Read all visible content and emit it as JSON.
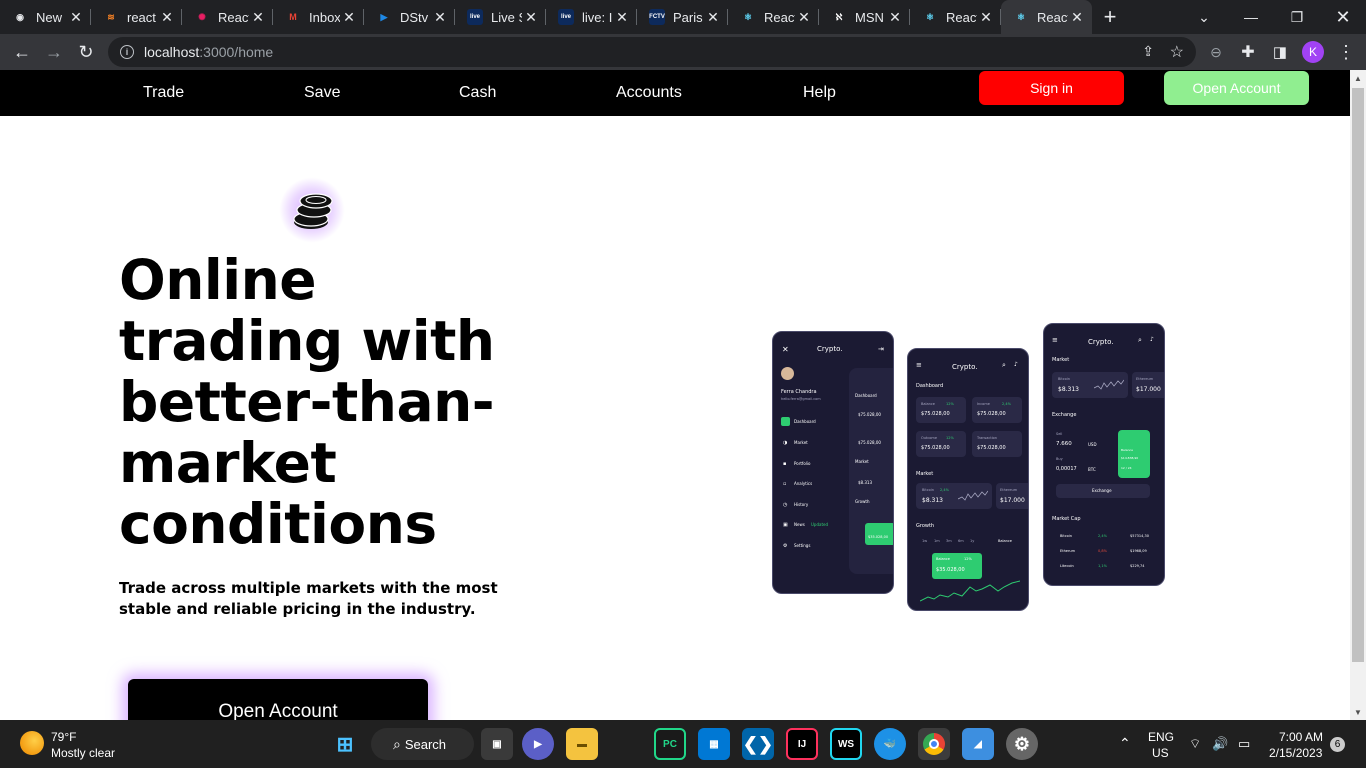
{
  "browser": {
    "tabs": [
      {
        "title": "New",
        "fav_color": "#e8eaed",
        "fav_glyph": "◉"
      },
      {
        "title": "react",
        "fav_color": "#f48024",
        "fav_glyph": "≋"
      },
      {
        "title": "React",
        "fav_color": "#e91e63",
        "fav_glyph": "✺"
      },
      {
        "title": "Inbox",
        "fav_color": "#ea4335",
        "fav_glyph": "M"
      },
      {
        "title": "DStv",
        "fav_color": "#1e88e5",
        "fav_glyph": "▶"
      },
      {
        "title": "Live S",
        "fav_color": "#0d47a1",
        "fav_glyph": "live"
      },
      {
        "title": "live: I",
        "fav_color": "#0d47a1",
        "fav_glyph": "live"
      },
      {
        "title": "Paris",
        "fav_color": "#c62828",
        "fav_glyph": "FCTV"
      },
      {
        "title": "React",
        "fav_color": "#61dafb",
        "fav_glyph": "⚛"
      },
      {
        "title": "MSN",
        "fav_color": "#ffffff",
        "fav_glyph": "ℵ"
      },
      {
        "title": "React",
        "fav_color": "#61dafb",
        "fav_glyph": "⚛"
      },
      {
        "title": "React",
        "fav_color": "#61dafb",
        "fav_glyph": "⚛"
      }
    ],
    "active_tab_index": 11,
    "url_host": "localhost",
    "url_path": ":3000/home",
    "profile_initial": "K"
  },
  "site": {
    "nav": [
      "Trade",
      "Save",
      "Cash",
      "Accounts",
      "Help"
    ],
    "sign_in": "Sign in",
    "open_account_top": "Open Account",
    "headline": "Online trading with better-than-market conditions",
    "subtext": "Trade across multiple markets with the most stable and reliable pricing in the industry.",
    "cta": "Open Account"
  },
  "phones": {
    "brand": "Crypto.",
    "left": {
      "user_name": "Ferra Chandra",
      "user_email": "hello.ferra@gmail.com",
      "menu": [
        "Dashboard",
        "Market",
        "Portfolio",
        "Analytics",
        "History",
        "News",
        "Settings"
      ],
      "news_badge": "Updated",
      "mini_dashboard": "Dashboard",
      "mini_values": [
        "$75.028,00",
        "$75.028,00"
      ],
      "mini_market": "Market",
      "mini_bitcoin": "$8.313",
      "mini_growth": "Growth",
      "mini_balance": "$35.028,00"
    },
    "middle": {
      "dashboard": "Dashboard",
      "cards": [
        {
          "label": "Balance",
          "change": "12%",
          "value": "$75.028,00"
        },
        {
          "label": "Income",
          "change": "2,4%",
          "value": "$75.028,00"
        },
        {
          "label": "Outcome",
          "change": "12%",
          "value": "$75.028,00"
        },
        {
          "label": "Transaction",
          "change": "",
          "value": "$75.028,00"
        }
      ],
      "market": "Market",
      "bitcoin_label": "Bitcoin",
      "bitcoin_change": "2,4%",
      "bitcoin_value": "$8.313",
      "ethereum_label": "Ethereum",
      "ethereum_value": "$17.000",
      "growth": "Growth",
      "periods": [
        "1w",
        "1m",
        "3m",
        "6m",
        "1y"
      ],
      "balance_filter": "Balance",
      "tooltip_label": "Balance",
      "tooltip_change": "12%",
      "tooltip_value": "$35.028,00"
    },
    "right": {
      "market": "Market",
      "bitcoin_label": "Bitcoin",
      "bitcoin_value": "$8.313",
      "ethereum_label": "Ethereum",
      "ethereum_value": "$17.000",
      "exchange": "Exchange",
      "sell_label": "Sell",
      "sell_value": "7.660",
      "sell_currency": "USD",
      "buy_label": "Buy",
      "buy_value": "0,00017",
      "buy_currency": "BTC",
      "card_label": "Balance",
      "card_value": "$14.838,90",
      "card_expiry": "12 / 24",
      "exchange_button": "Exchange",
      "market_cap": "Market Cap",
      "coins": [
        {
          "name": "Bitcoin",
          "change": "2,4%",
          "value": "$57314,30"
        },
        {
          "name": "Etherum",
          "change": "0,8%",
          "value": "$1968,09"
        },
        {
          "name": "Litecoin",
          "change": "1,1%",
          "value": "$229,74"
        }
      ]
    }
  },
  "taskbar": {
    "temperature": "79°F",
    "weather": "Mostly clear",
    "search": "Search",
    "lang": "ENG",
    "region": "US",
    "time": "7:00 AM",
    "date": "2/15/2023",
    "notifications": "6"
  }
}
